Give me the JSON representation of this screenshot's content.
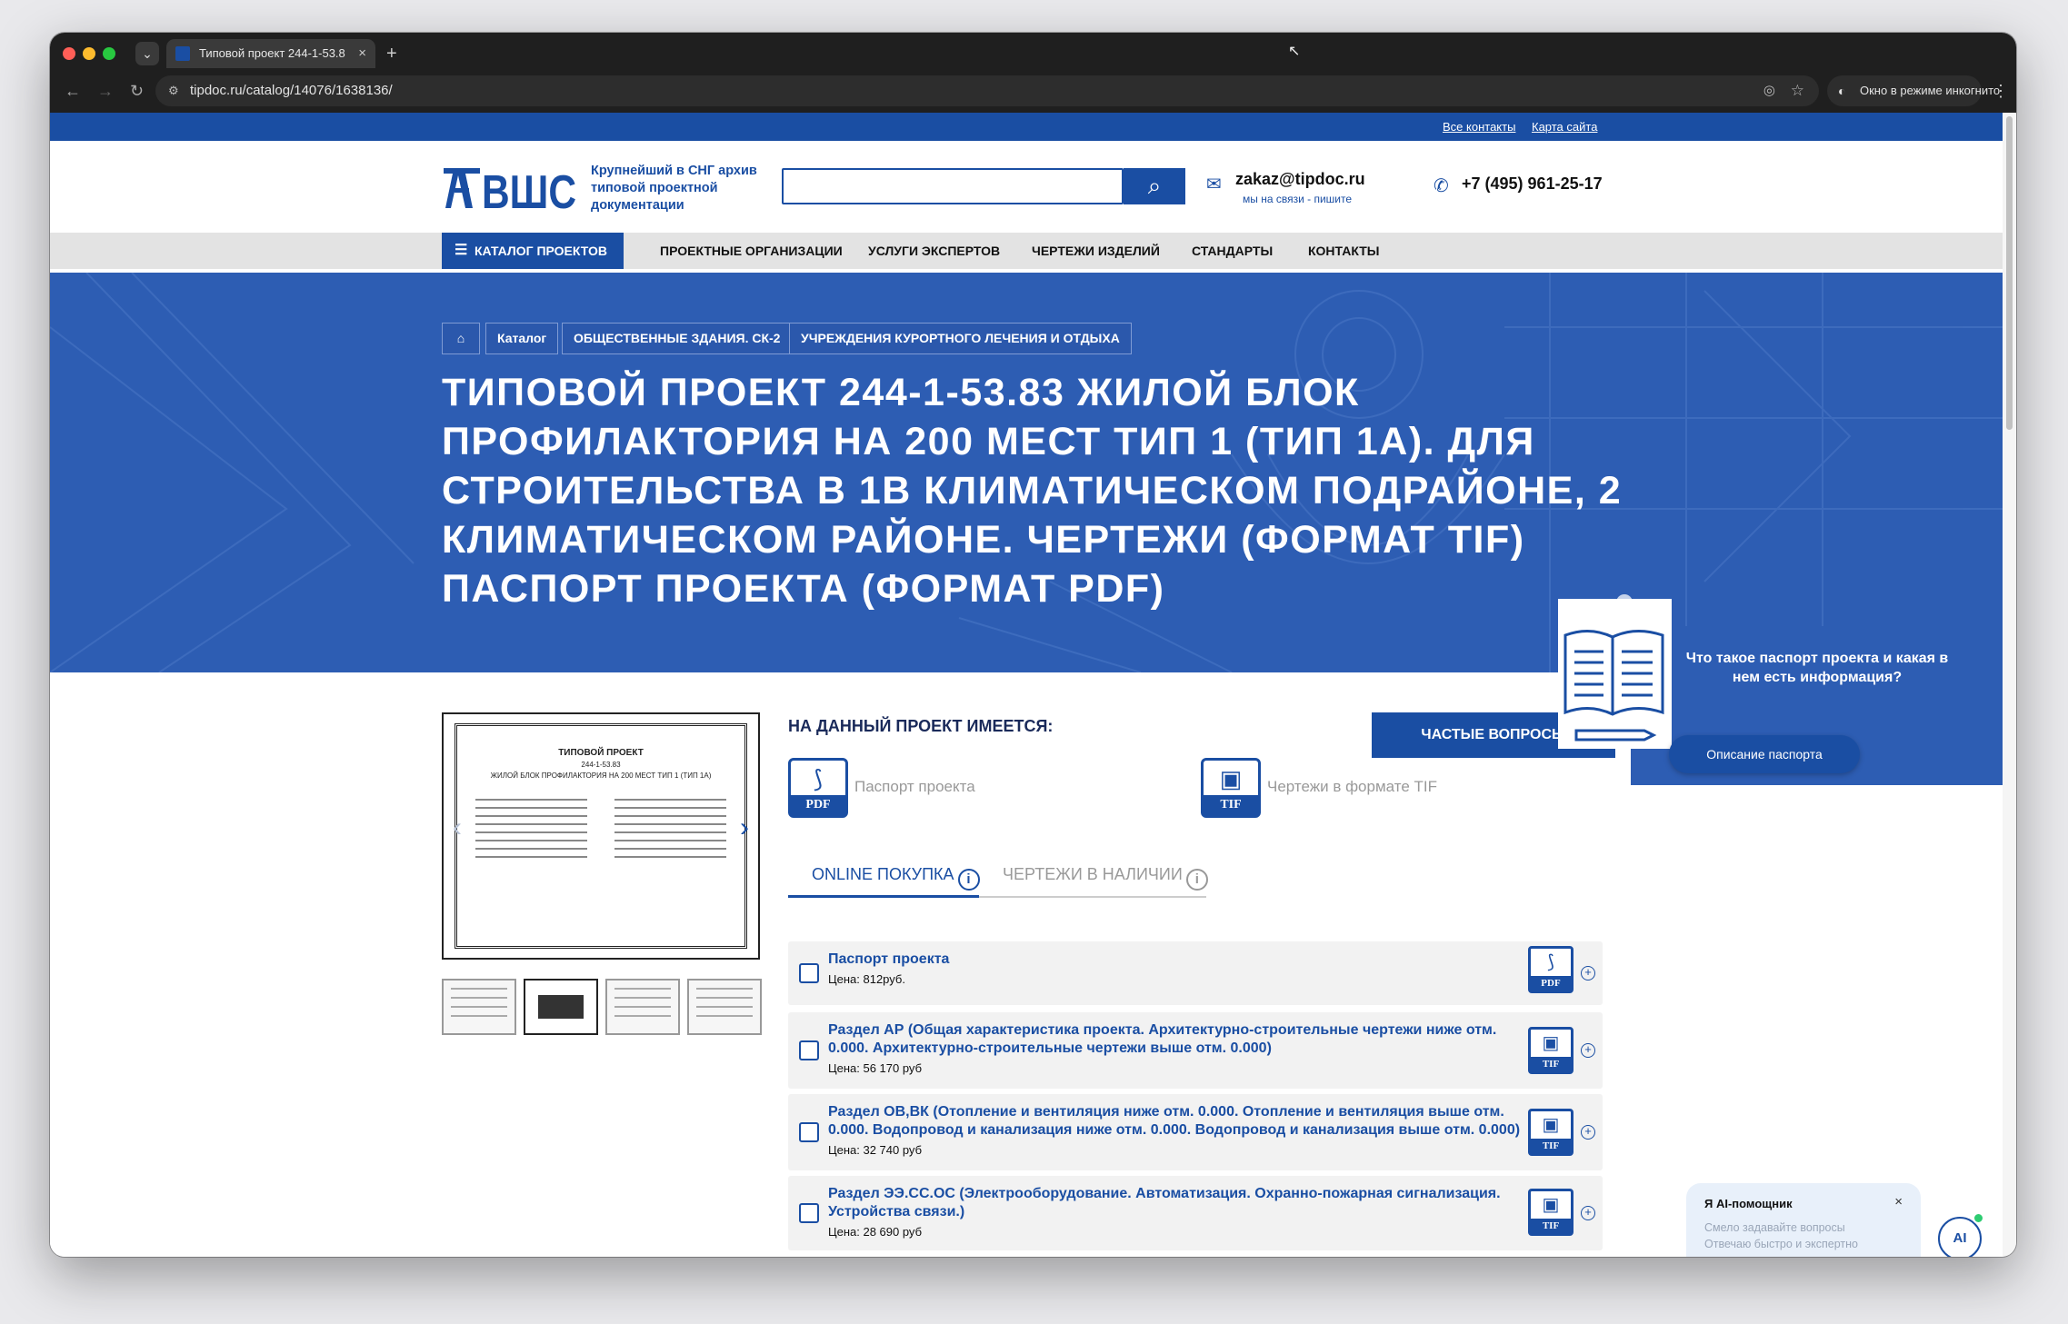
{
  "browser": {
    "tab_title": "Типовой проект 244-1-53.8",
    "url": "tipdoc.ru/catalog/14076/1638136/",
    "incognito_label": "Окно в режиме инкогнито"
  },
  "topbar": {
    "contacts_link": "Все контакты",
    "sitemap_link": "Карта сайта"
  },
  "header": {
    "logo_text": "ВШС",
    "tagline": "Крупнейший в СНГ архив типовой проектной документации",
    "search_placeholder": "",
    "email": "zakaz@tipdoc.ru",
    "email_sub": "мы на связи - пишите",
    "phone": "+7 (495) 961-25-17"
  },
  "nav": {
    "catalog": "КАТАЛОГ ПРОЕКТОВ",
    "items": [
      "ПРОЕКТНЫЕ ОРГАНИЗАЦИИ",
      "УСЛУГИ ЭКСПЕРТОВ",
      "ЧЕРТЕЖИ ИЗДЕЛИЙ",
      "СТАНДАРТЫ",
      "КОНТАКТЫ"
    ]
  },
  "breadcrumbs": [
    "Каталог",
    "ОБЩЕСТВЕННЫЕ ЗДАНИЯ. СК-2",
    "УЧРЕЖДЕНИЯ КУРОРТНОГО ЛЕЧЕНИЯ И ОТДЫХА"
  ],
  "title_lines": [
    "ТИПОВОЙ ПРОЕКТ 244-1-53.83 ЖИЛОЙ БЛОК",
    "ПРОФИЛАКТОРИЯ НА 200 МЕСТ ТИП 1 (ТИП 1А). ДЛЯ",
    "СТРОИТЕЛЬСТВА В 1В КЛИМАТИЧЕСКОМ ПОДРАЙОНЕ, 2",
    "КЛИМАТИЧЕСКОМ РАЙОНЕ. ЧЕРТЕЖИ (ФОРМАТ TIF)",
    "ПАСПОРТ ПРОЕКТА (ФОРМАТ PDF)"
  ],
  "preview": {
    "doc_title": "ТИПОВОЙ ПРОЕКТ",
    "doc_code": "244-1-53.83",
    "doc_subtitle": "ЖИЛОЙ БЛОК ПРОФИЛАКТОРИЯ НА 200 МЕСТ ТИП 1 (ТИП 1А)"
  },
  "available": {
    "label": "НА ДАННЫЙ ПРОЕКТ ИМЕЕТСЯ:",
    "faq_button": "ЧАСТЫЕ ВОПРОСЫ",
    "files": [
      {
        "type": "PDF",
        "label": "Паспорт проекта"
      },
      {
        "type": "TIF",
        "label": "Чертежи в формате TIF"
      }
    ]
  },
  "purchase_tabs": [
    "ONLINE ПОКУПКА",
    "ЧЕРТЕЖИ В НАЛИЧИИ"
  ],
  "items": [
    {
      "name": "Паспорт проекта",
      "price": "Цена: 812руб.",
      "type": "PDF"
    },
    {
      "name": "Раздел АР (Общая характеристика проекта. Архитектурно-строительные чертежи ниже отм. 0.000. Архитектурно-строительные чертежи выше отм. 0.000)",
      "price": "Цена: 56 170 руб",
      "type": "TIF"
    },
    {
      "name": "Раздел ОВ,ВК (Отопление и вентиляция ниже отм. 0.000. Отопление и вентиляция выше отм. 0.000. Водопровод и канализация ниже отм. 0.000. Водопровод и канализация выше отм. 0.000)",
      "price": "Цена: 32 740 руб",
      "type": "TIF"
    },
    {
      "name": "Раздел ЭЭ.СС.ОС (Электрооборудование. Автоматизация. Охранно-пожарная сигнализация. Устройства связи.)",
      "price": "Цена: 28 690 руб",
      "type": "TIF"
    }
  ],
  "passport_popup": {
    "question": "Что такое паспорт проекта и какая в нем есть информация?",
    "button": "Описание паспорта"
  },
  "ai_widget": {
    "title": "Я AI-помощник",
    "line1": "Смело задавайте вопросы",
    "line2": "Отвечаю быстро и экспертно",
    "avatar": "AI"
  },
  "colors": {
    "brand": "#1a4ea3",
    "hero": "#2d5db3"
  }
}
